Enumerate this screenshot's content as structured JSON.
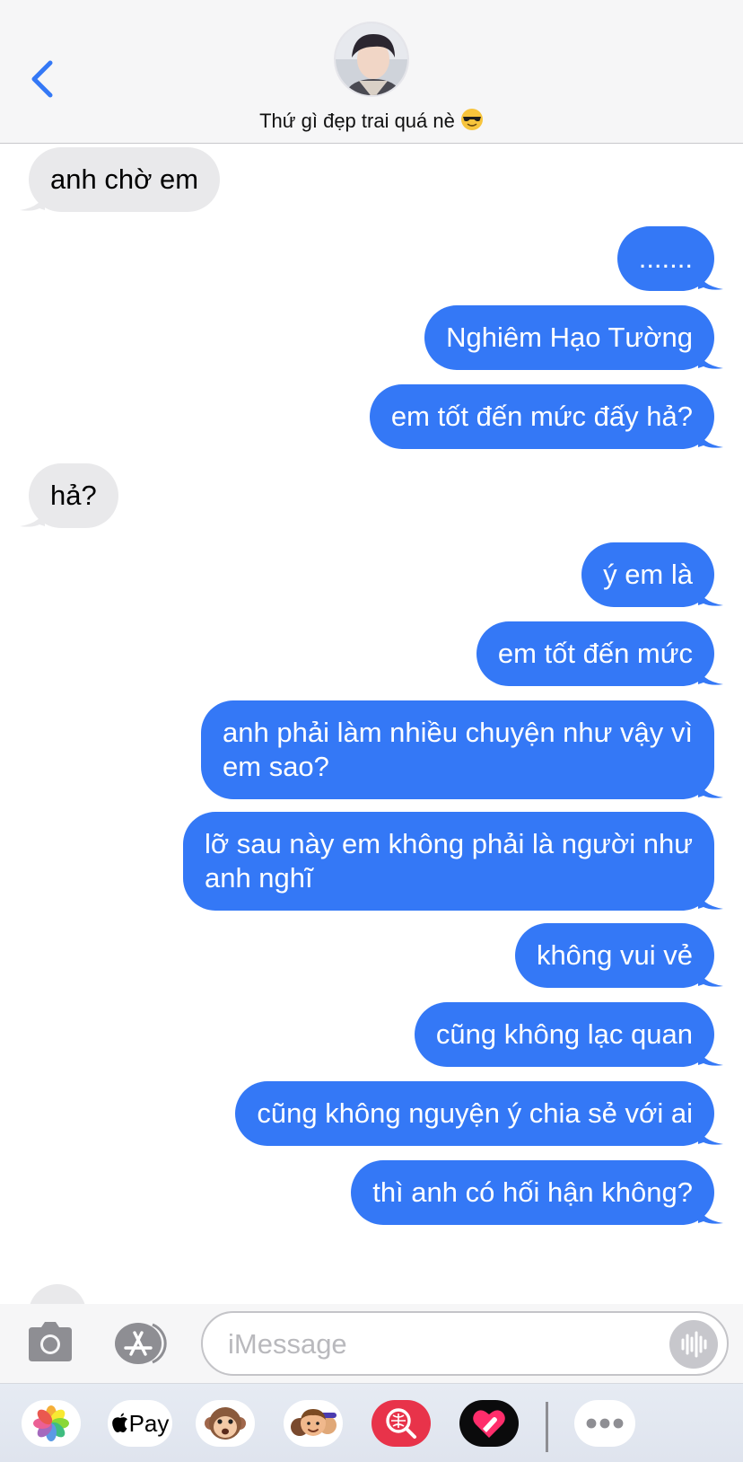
{
  "header": {
    "contact_name": "Thứ gì đẹp trai quá nè",
    "contact_emoji": "😎",
    "back_icon": "chevron-left-icon",
    "accent_color": "#3478f6"
  },
  "messages": [
    {
      "side": "in",
      "text": "anh chờ em"
    },
    {
      "side": "out",
      "text": "......."
    },
    {
      "side": "out",
      "text": "Nghiêm Hạo Tường"
    },
    {
      "side": "out",
      "text": "em tốt đến mức đấy hả?"
    },
    {
      "side": "in",
      "text": "hả?"
    },
    {
      "side": "out",
      "text": "ý em là"
    },
    {
      "side": "out",
      "text": "em tốt đến mức"
    },
    {
      "side": "out",
      "text": "anh phải làm nhiều chuyện như vậy vì\nem sao?"
    },
    {
      "side": "out",
      "text": "lỡ sau này em không phải là người như\nanh nghĩ"
    },
    {
      "side": "out",
      "text": "không vui vẻ"
    },
    {
      "side": "out",
      "text": "cũng không lạc quan"
    },
    {
      "side": "out",
      "text": "cũng không nguyện ý chia sẻ với ai"
    },
    {
      "side": "out",
      "text": "thì anh có hối hận không?"
    }
  ],
  "composer": {
    "placeholder": "iMessage",
    "camera_icon": "camera-icon",
    "apps_icon": "app-store-icon",
    "audio_icon": "audio-waveform-icon"
  },
  "drawer": {
    "apple_pay_label": "Pay",
    "apps": [
      "photos-icon",
      "apple-pay-icon",
      "animoji-icon",
      "memoji-icon",
      "image-search-icon",
      "digital-touch-icon",
      "more-icon"
    ]
  }
}
